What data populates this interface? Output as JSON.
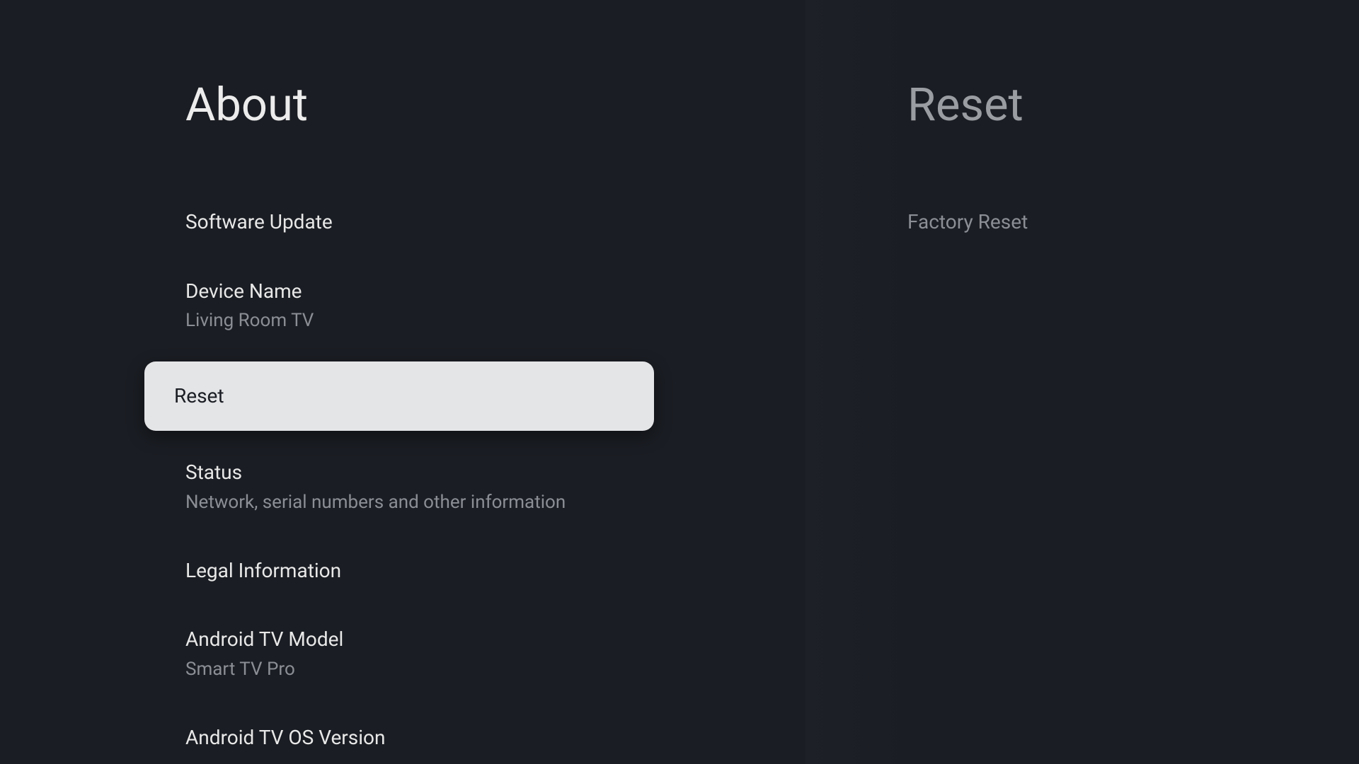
{
  "left": {
    "title": "About",
    "items": [
      {
        "label": "Software Update",
        "sub": ""
      },
      {
        "label": "Device Name",
        "sub": "Living Room TV"
      },
      {
        "label": "Reset",
        "sub": ""
      },
      {
        "label": "Status",
        "sub": "Network, serial numbers and other information"
      },
      {
        "label": "Legal Information",
        "sub": ""
      },
      {
        "label": "Android TV Model",
        "sub": "Smart TV Pro"
      },
      {
        "label": "Android TV OS Version",
        "sub": ""
      }
    ]
  },
  "right": {
    "title": "Reset",
    "items": [
      {
        "label": "Factory Reset"
      }
    ]
  }
}
